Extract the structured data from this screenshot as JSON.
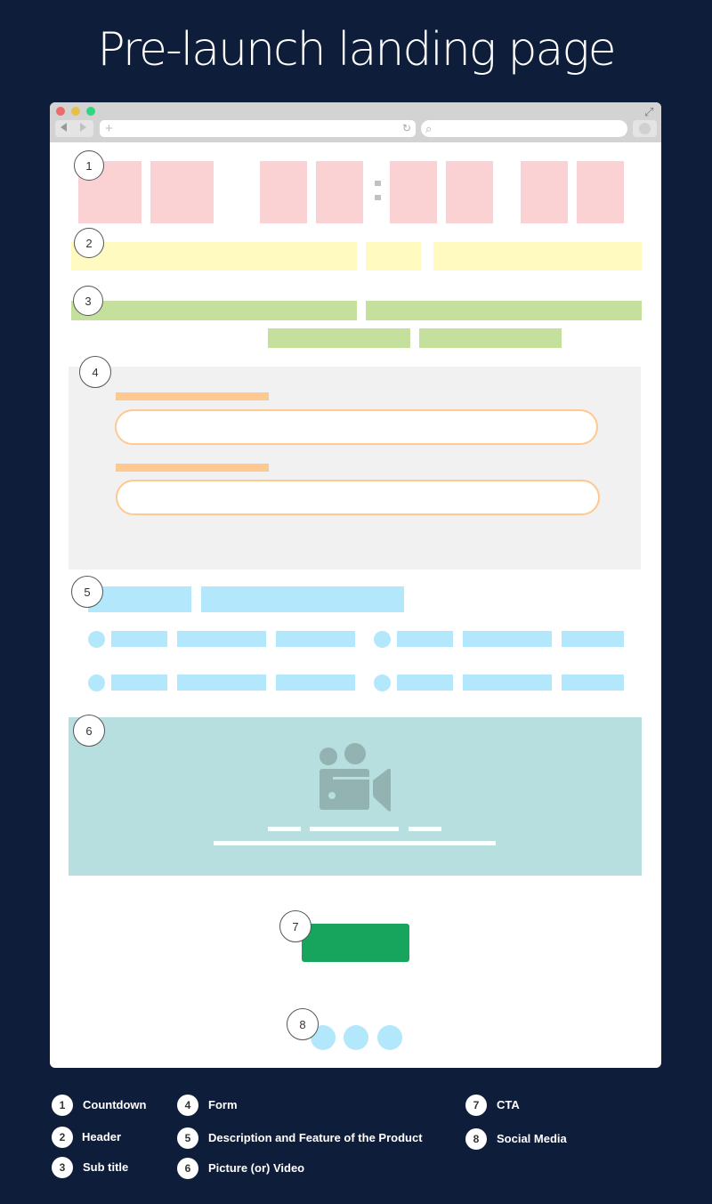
{
  "title": "Pre-launch landing page",
  "browser": {
    "window_controls": [
      "close",
      "minimize",
      "maximize"
    ],
    "colors": {
      "close": "#ec6b6b",
      "minimize": "#e6bf45",
      "maximize": "#2fd57f"
    },
    "url_placeholder_icon": "+",
    "reload_icon": "↻",
    "search_icon": "⌕",
    "expand_icon": "⤢"
  },
  "callouts": {
    "countdown": "1",
    "header": "2",
    "subtitle": "3",
    "form": "4",
    "description": "5",
    "media": "6",
    "cta": "7",
    "social": "8"
  },
  "countdown": {
    "separator": ":"
  },
  "legend": [
    {
      "num": "1",
      "label": "Countdown"
    },
    {
      "num": "2",
      "label": "Header"
    },
    {
      "num": "3",
      "label": "Sub title"
    },
    {
      "num": "4",
      "label": "Form"
    },
    {
      "num": "5",
      "label": "Description and Feature of the Product"
    },
    {
      "num": "6",
      "label": "Picture (or) Video"
    },
    {
      "num": "7",
      "label": "CTA"
    },
    {
      "num": "8",
      "label": "Social Media"
    }
  ],
  "colors": {
    "background": "#0e1e3a",
    "countdown": "#fad2d3",
    "header": "#fffac0",
    "subtitle": "#c5df9c",
    "form_panel": "#f1f1f1",
    "form_accent": "#fec990",
    "description": "#b2e7fc",
    "media": "#b8dfdf",
    "media_icon": "#93b3b3",
    "cta": "#17a55e",
    "social": "#b2e7fc"
  }
}
